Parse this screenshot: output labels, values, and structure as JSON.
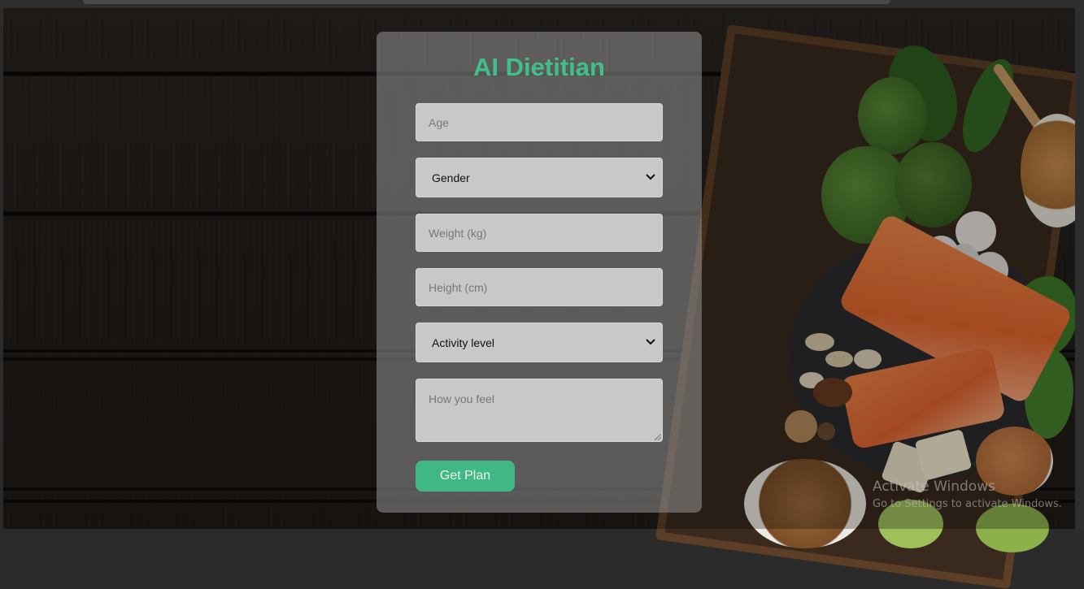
{
  "app": {
    "title": "AI Dietitian"
  },
  "form": {
    "age": {
      "placeholder": "Age",
      "value": ""
    },
    "gender": {
      "selected": "Gender",
      "options": [
        "Gender"
      ]
    },
    "weight": {
      "placeholder": "Weight (kg)",
      "value": ""
    },
    "height": {
      "placeholder": "Height (cm)",
      "value": ""
    },
    "activity": {
      "selected": "Activity level",
      "options": [
        "Activity level"
      ]
    },
    "feel": {
      "placeholder": "How you feel",
      "value": ""
    },
    "submit_label": "Get Plan"
  },
  "watermark": {
    "title": "Activate Windows",
    "subtitle": "Go to Settings to activate Windows."
  },
  "colors": {
    "accent": "#3fbf8a",
    "button": "#3fb886",
    "card_bg": "rgba(150,150,150,0.55)",
    "page_bg": "#231e1b"
  },
  "icons": {
    "select_chevron": "chevron-down-icon",
    "textarea_resize": "resize-grip-icon"
  }
}
